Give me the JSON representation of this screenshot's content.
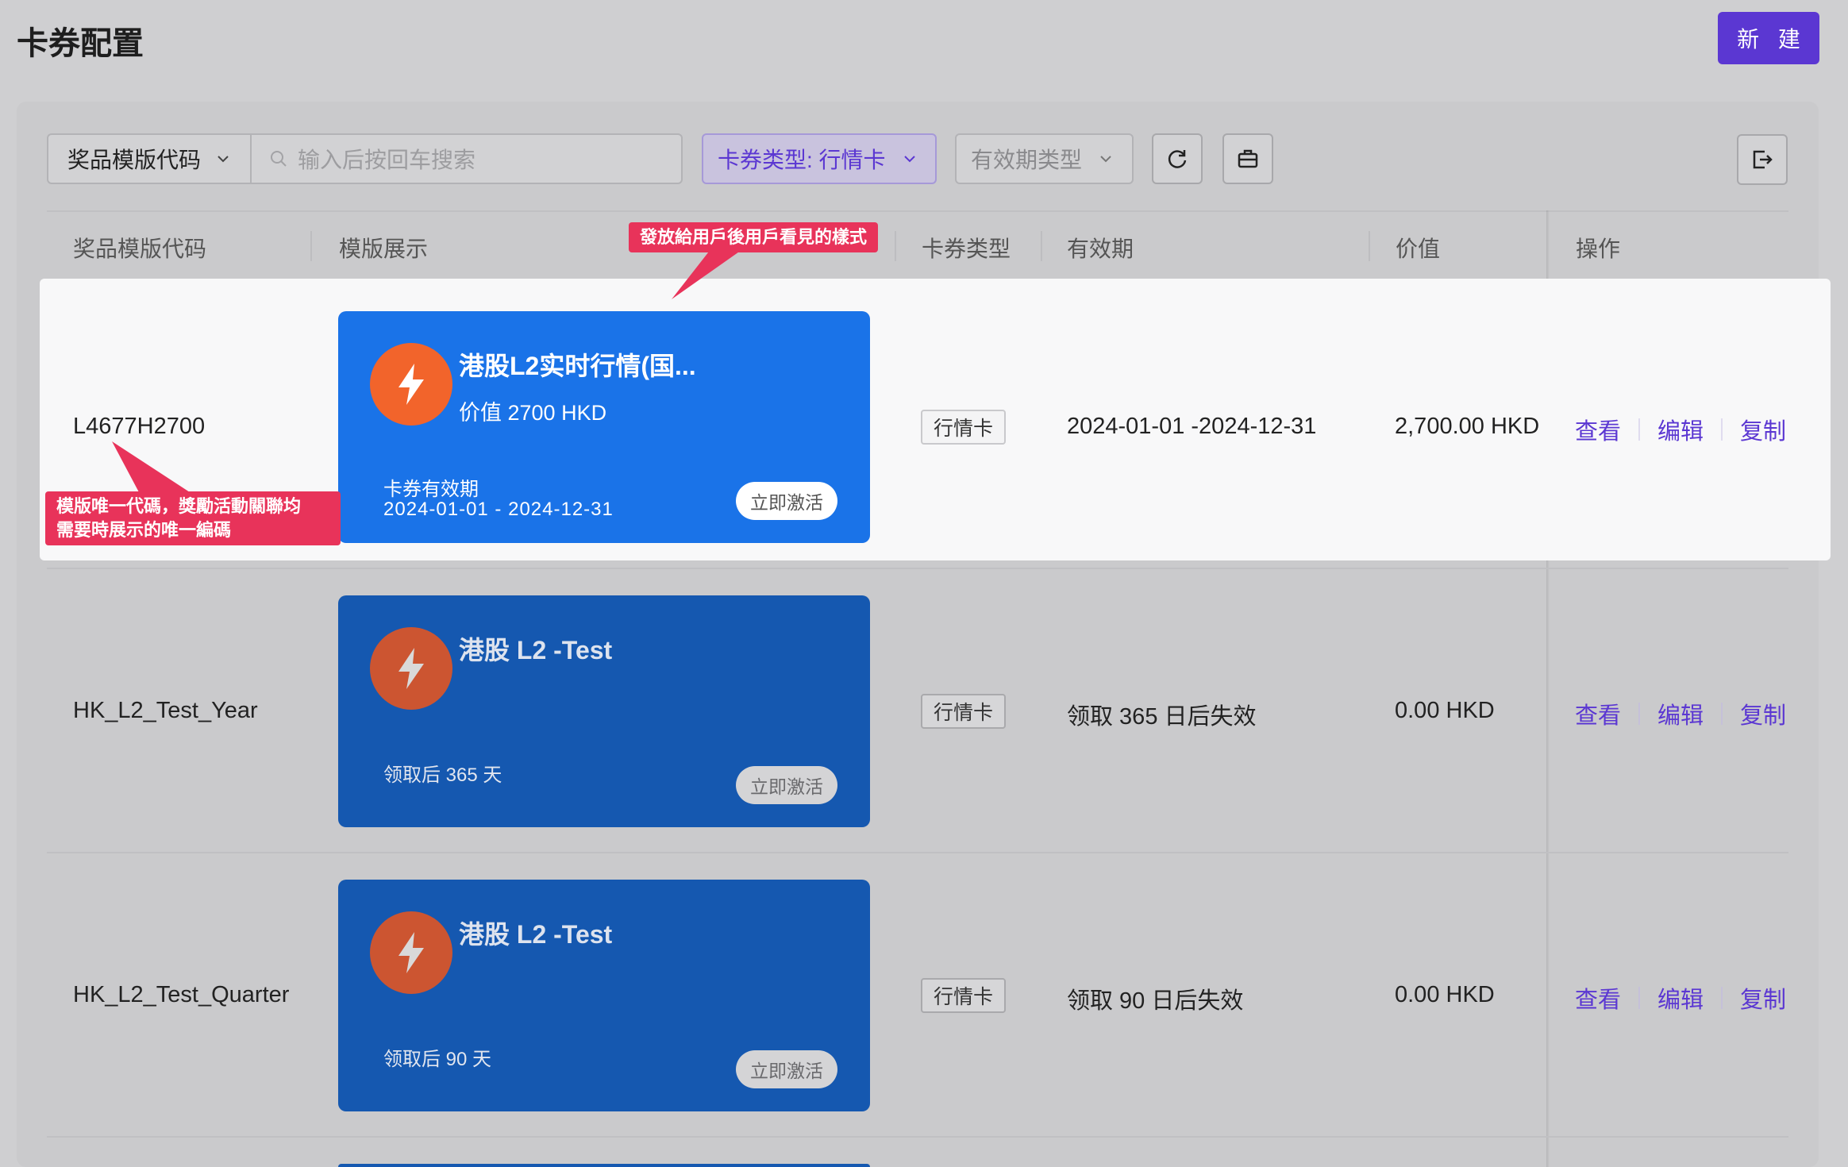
{
  "page": {
    "title": "卡券配置",
    "new_button": "新 建"
  },
  "toolbar": {
    "code_select_label": "奖品模版代码",
    "search_placeholder": "输入后按回车搜索",
    "type_filter_label": "卡券类型: 行情卡",
    "validity_filter_label": "有效期类型",
    "icons": [
      "chevron-down-icon",
      "search-icon",
      "refresh-icon",
      "toolbox-icon",
      "export-icon"
    ]
  },
  "table": {
    "headers": {
      "code": "奖品模版代码",
      "template": "模版展示",
      "type": "卡券类型",
      "validity": "有效期",
      "value": "价值",
      "action": "操作"
    },
    "actions": {
      "view": "查看",
      "edit": "编辑",
      "copy": "复制"
    },
    "rows": [
      {
        "code": "L4677H2700",
        "type": "行情卡",
        "validity": "2024-01-01 -2024-12-31",
        "value": "2,700.00 HKD",
        "card": {
          "title": "港股L2实时行情(国...",
          "value": "价值 2700 HKD",
          "valid_label": "卡券有效期",
          "valid_range": "2024-01-01 - 2024-12-31",
          "activate": "立即激活"
        }
      },
      {
        "code": "HK_L2_Test_Year",
        "type": "行情卡",
        "validity": "领取 365 日后失效",
        "value": "0.00 HKD",
        "card": {
          "title": "港股 L2 -Test",
          "sub": "领取后 365 天",
          "activate": "立即激活"
        }
      },
      {
        "code": "HK_L2_Test_Quarter",
        "type": "行情卡",
        "validity": "领取 90 日后失效",
        "value": "0.00 HKD",
        "card": {
          "title": "港股 L2 -Test",
          "sub": "领取后 90 天",
          "activate": "立即激活"
        }
      }
    ]
  },
  "annotations": {
    "card_style": "發放給用戶後用戶看見的樣式",
    "code_line1": "模版唯一代碼，獎勵活動關聯均",
    "code_line2": "需要時展示的唯一編碼"
  },
  "colors": {
    "accent": "#5b37d2",
    "callout": "#e8335a",
    "card_active": "#1a73e8",
    "card_dim": "#1558b0",
    "bolt_orange": "#f2642b"
  }
}
